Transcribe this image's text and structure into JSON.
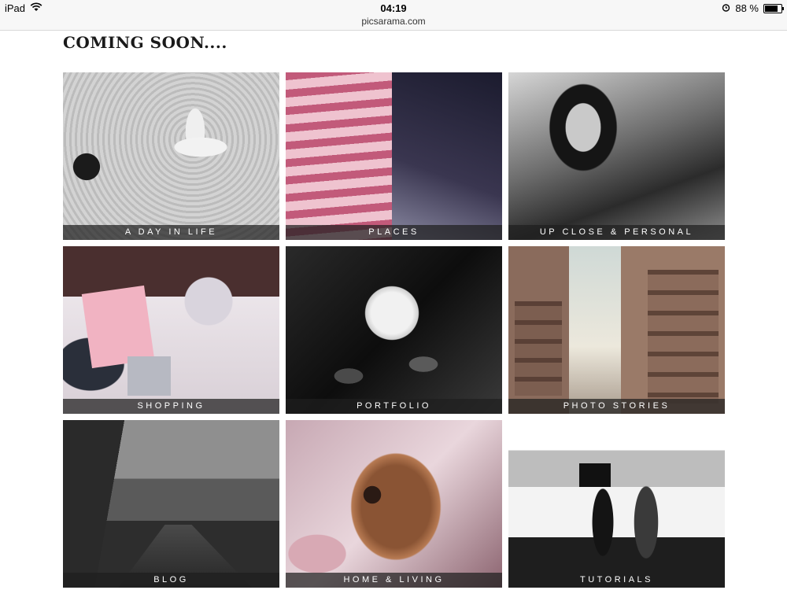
{
  "status_bar": {
    "device": "iPad",
    "time": "04:19",
    "url": "picsarama.com",
    "battery_percent": "88 %",
    "battery_level": 0.88
  },
  "page": {
    "heading": "COMING SOON...."
  },
  "tiles": [
    {
      "label": "A DAY IN LIFE"
    },
    {
      "label": "PLACES"
    },
    {
      "label": "UP CLOSE & PERSONAL"
    },
    {
      "label": "SHOPPING"
    },
    {
      "label": "PORTFOLIO"
    },
    {
      "label": "PHOTO STORIES"
    },
    {
      "label": "BLOG"
    },
    {
      "label": "HOME & LIVING"
    },
    {
      "label": "TUTORIALS"
    }
  ],
  "icons": {
    "wifi": "wifi-icon",
    "alarm": "alarm-clock-icon",
    "battery": "battery-icon"
  }
}
